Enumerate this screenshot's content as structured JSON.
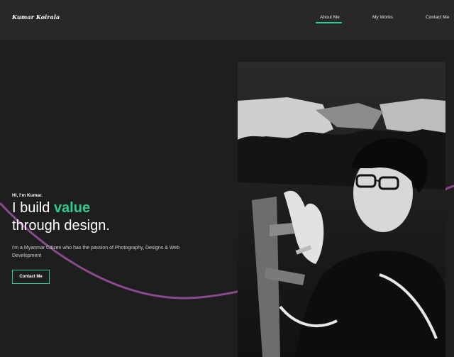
{
  "header": {
    "logo": "Kumar Koirala",
    "nav": [
      {
        "label": "About Me",
        "active": true
      },
      {
        "label": "My Works",
        "active": false
      },
      {
        "label": "Contact Me",
        "active": false
      }
    ]
  },
  "hero": {
    "greeting": "Hi, I'm Kumar.",
    "headline_before": "I build ",
    "headline_accent": "value",
    "headline_after": "through design.",
    "bio": "I'm a Myanmar Citizen who has the passion of Photography, Designs & Web Development",
    "cta_label": "Contact Me"
  },
  "colors": {
    "accent": "#2ecc8f",
    "curve": "#8a4a8f",
    "background": "#1e1e1e",
    "navbar": "#282828"
  }
}
